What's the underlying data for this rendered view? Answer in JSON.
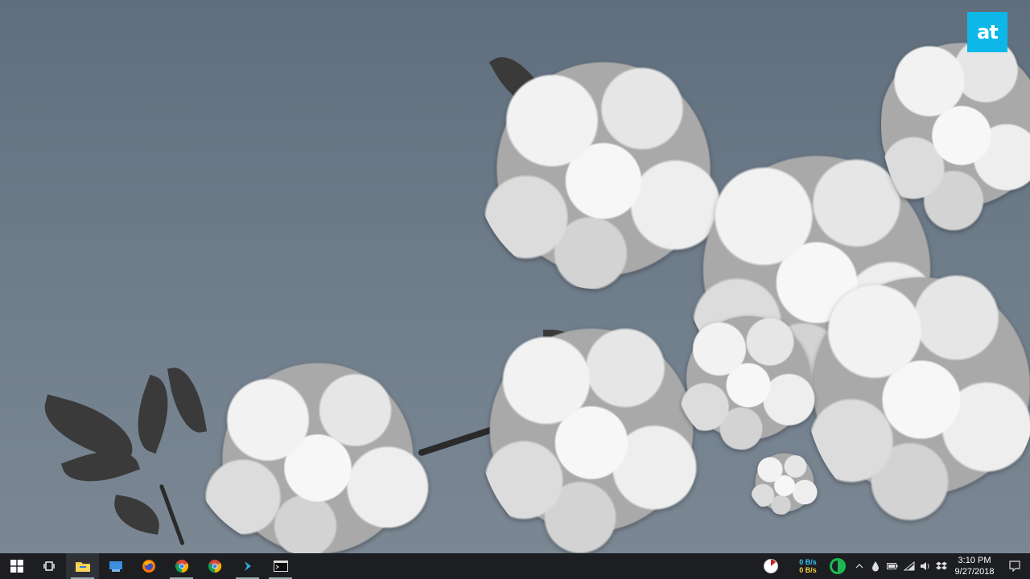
{
  "desktop": {
    "logo_text": "at",
    "logo_color": "#0db8e8"
  },
  "taskbar": {
    "background": "#1c1e21",
    "pinned": [
      {
        "name": "start-button",
        "icon": "windows-logo-icon"
      },
      {
        "name": "task-view-button",
        "icon": "task-view-icon"
      },
      {
        "name": "file-explorer-button",
        "icon": "folder-icon",
        "state": "active"
      },
      {
        "name": "app-blue-button",
        "icon": "blue-app-icon"
      },
      {
        "name": "firefox-button",
        "icon": "firefox-icon"
      },
      {
        "name": "chrome-button",
        "icon": "chrome-icon"
      },
      {
        "name": "chrome-canary-button",
        "icon": "chrome-icon"
      },
      {
        "name": "dev-tool-button",
        "icon": "arrow-app-icon"
      },
      {
        "name": "terminal-button",
        "icon": "terminal-icon"
      }
    ],
    "tray": {
      "net_up": "0 B/s",
      "net_down": "0 B/s",
      "time": "3:10 PM",
      "date": "9/27/2018"
    }
  }
}
